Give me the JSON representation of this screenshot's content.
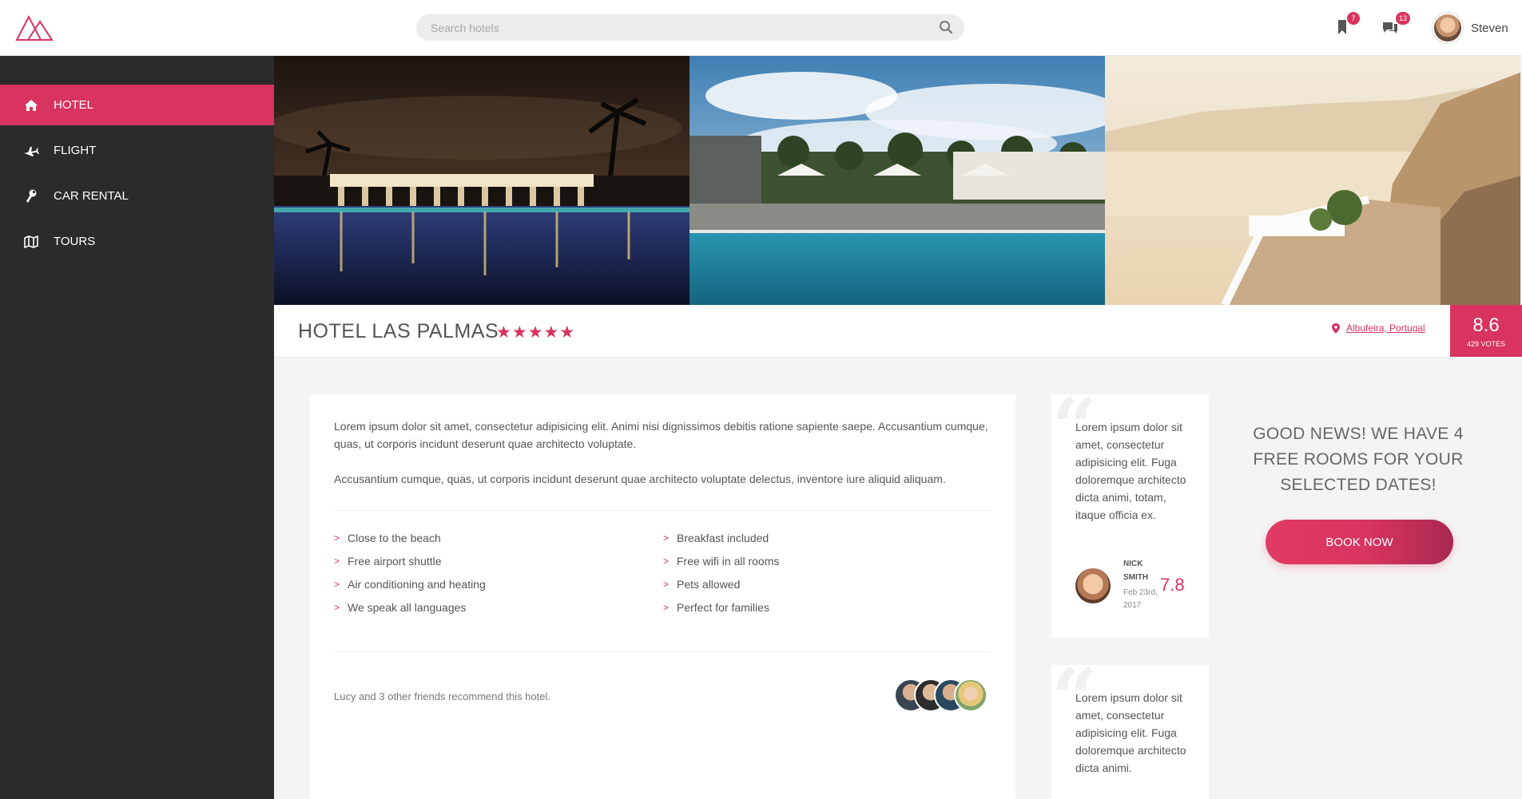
{
  "header": {
    "search_placeholder": "Search hotels",
    "bookmarks_badge": "7",
    "messages_badge": "13",
    "user_name": "Steven"
  },
  "sidebar": {
    "items": [
      {
        "label": "HOTEL",
        "icon": "home-icon",
        "active": true
      },
      {
        "label": "FLIGHT",
        "icon": "airplane-icon",
        "active": false
      },
      {
        "label": "CAR RENTAL",
        "icon": "wrench-icon",
        "active": false
      },
      {
        "label": "TOURS",
        "icon": "map-icon",
        "active": false
      }
    ]
  },
  "hotel": {
    "name": "HOTEL LAS PALMAS",
    "stars": "★★★★★",
    "location": "Albufeira, Portugal",
    "score": "8.6",
    "votes": "429 VOTES"
  },
  "description": {
    "p1": "Lorem ipsum dolor sit amet, consectetur adipisicing elit. Animi nisi dignissimos debitis ratione sapiente saepe. Accusantium cumque, quas, ut corporis incidunt deserunt quae architecto voluptate.",
    "p2": "Accusantium cumque, quas, ut corporis incidunt deserunt quae architecto voluptate delectus, inventore iure aliquid aliquam."
  },
  "features": {
    "left": [
      "Close to the beach",
      "Free airport shuttle",
      "Air conditioning and heating",
      "We speak all languages"
    ],
    "right": [
      "Breakfast included",
      "Free wifi in all rooms",
      "Pets allowed",
      "Perfect for families"
    ]
  },
  "recommend_text": "Lucy and 3 other friends recommend this hotel.",
  "reviews": [
    {
      "text": "Lorem ipsum dolor sit amet, consectetur adipisicing elit. Fuga doloremque architecto dicta animi, totam, itaque officia ex.",
      "name_line1": "NICK",
      "name_line2": "SMITH",
      "date_line1": "Feb 23rd,",
      "date_line2": "2017",
      "score": "7.8"
    },
    {
      "text": "Lorem ipsum dolor sit amet, consectetur adipisicing elit. Fuga doloremque architecto dicta animi."
    }
  ],
  "good_news": "GOOD NEWS! WE HAVE 4 FREE ROOMS FOR YOUR SELECTED DATES!",
  "book_button": "BOOK NOW",
  "colors": {
    "accent": "#d8345f",
    "sidebar": "#2b2b2c"
  }
}
